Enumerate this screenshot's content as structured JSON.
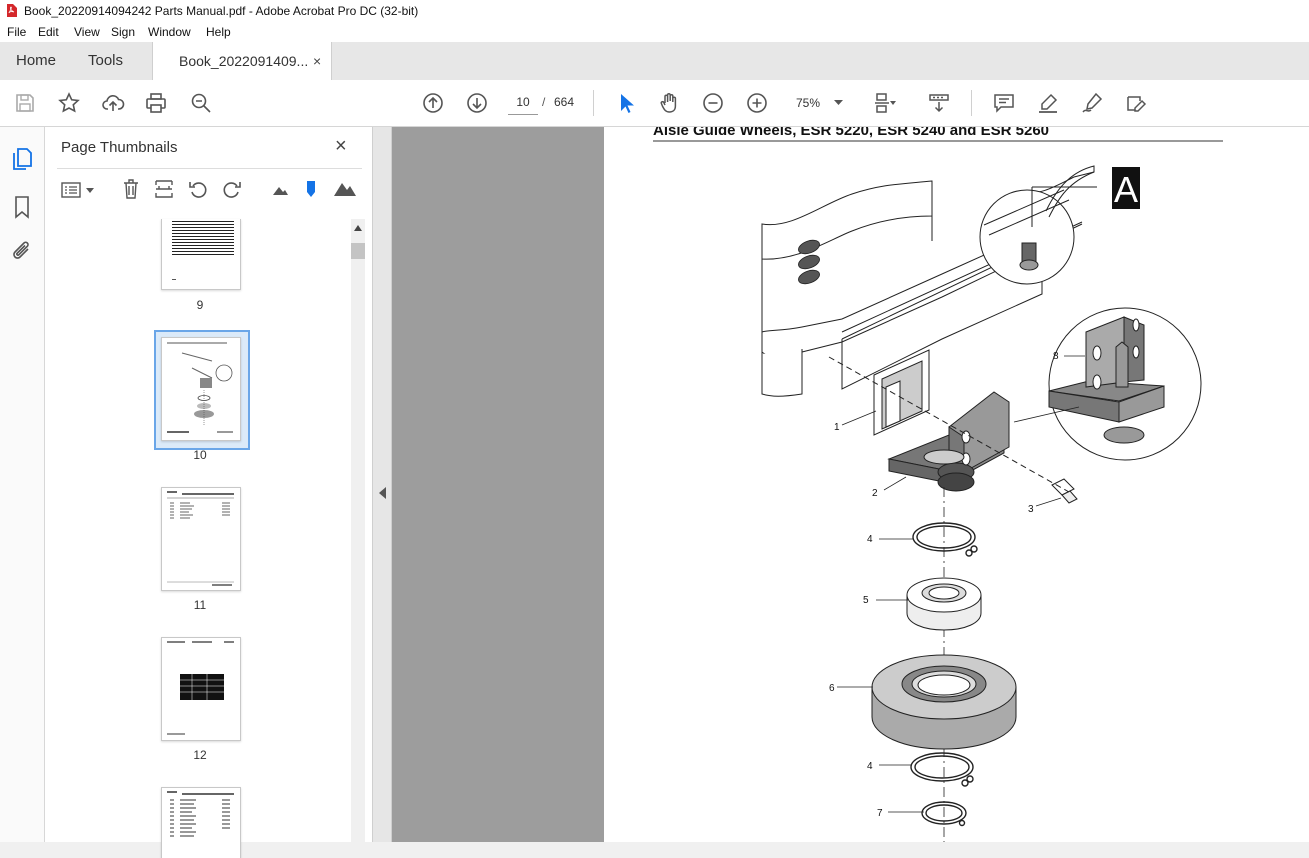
{
  "window": {
    "title": "Book_20220914094242 Parts Manual.pdf - Adobe Acrobat Pro DC (32-bit)"
  },
  "menu": [
    "File",
    "Edit",
    "View",
    "Sign",
    "Window",
    "Help"
  ],
  "tabs": {
    "home": "Home",
    "tools": "Tools",
    "document": "Book_2022091409...",
    "close": "×"
  },
  "toolbar": {
    "current_page": "10",
    "page_sep": "/",
    "total_pages": "664",
    "zoom": "75%"
  },
  "thumbnails": {
    "title": "Page Thumbnails",
    "close": "×",
    "pages": [
      "9",
      "10",
      "11",
      "12"
    ],
    "selected": "10"
  },
  "document": {
    "heading": "Aisle Guide Wheels, ESR 5220, ESR 5240 and ESR 5260",
    "detail_label": "A",
    "callouts": [
      "1",
      "2",
      "3",
      "4",
      "5",
      "6",
      "4",
      "7",
      "8"
    ]
  },
  "colors": {
    "accent": "#1473e6",
    "pdf_red": "#d4272b",
    "doc_bg": "#9d9d9d"
  }
}
